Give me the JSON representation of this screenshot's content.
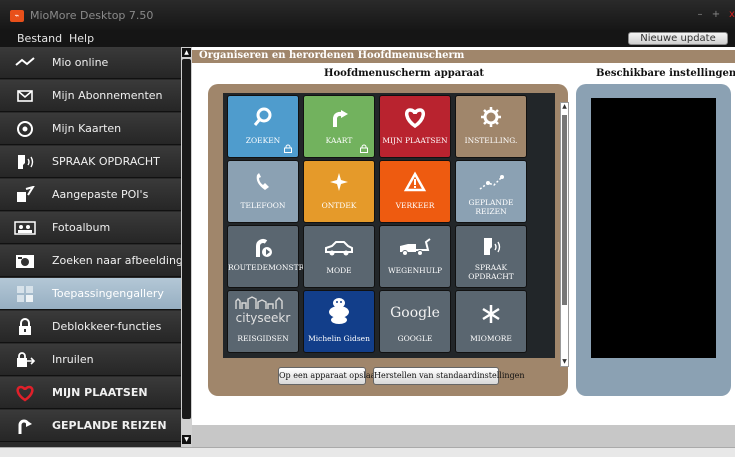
{
  "window": {
    "title": "MioMore Desktop 7.50"
  },
  "menu": {
    "items": [
      "Bestand",
      "Help"
    ],
    "update_button": "Nieuwe update"
  },
  "sidebar": {
    "items": [
      {
        "label": "Mio online",
        "icon": "mio-online-icon"
      },
      {
        "label": "Mijn Abonnementen",
        "icon": "envelope-icon"
      },
      {
        "label": "Mijn Kaarten",
        "icon": "map-compass-icon"
      },
      {
        "label": "SPRAAK OPDRACHT",
        "icon": "voice-command-icon"
      },
      {
        "label": "Aangepaste POI's",
        "icon": "custom-poi-icon"
      },
      {
        "label": "Fotoalbum",
        "icon": "photo-album-icon"
      },
      {
        "label": "Zoeken naar afbeeldingen",
        "icon": "camera-icon"
      },
      {
        "label": "Toepassingengallery",
        "icon": "app-gallery-icon",
        "active": true
      },
      {
        "label": "Deblokkeer-functies",
        "icon": "lock-icon"
      },
      {
        "label": "Inruilen",
        "icon": "trade-in-icon"
      },
      {
        "label": "MIJN PLAATSEN",
        "icon": "heart-icon"
      },
      {
        "label": "GEPLANDE REIZEN",
        "icon": "planned-trip-icon"
      }
    ]
  },
  "main": {
    "header": "Organiseren en herordenen Hoofdmenuscherm",
    "device_title": "Hoofdmenuscherm apparaat",
    "available_title": "Beschikbare instellingen",
    "tiles": [
      {
        "label": "ZOEKEN",
        "color": "#4f9ccd",
        "icon": "search-icon",
        "locked": true
      },
      {
        "label": "KAART",
        "color": "#72b25e",
        "icon": "map-icon",
        "locked": true
      },
      {
        "label": "MIJN PLAATSEN",
        "color": "#b9232f",
        "icon": "heart-icon",
        "locked": false
      },
      {
        "label": "INSTELLING.",
        "color": "#a0866b",
        "icon": "gear-icon",
        "locked": false
      },
      {
        "label": "TELEFOON",
        "color": "#8ba1b3",
        "icon": "phone-icon",
        "locked": false
      },
      {
        "label": "ONTDEK",
        "color": "#e59a2a",
        "icon": "sparkle-icon",
        "locked": false
      },
      {
        "label": "VERKEER",
        "color": "#ee5b10",
        "icon": "traffic-warning-icon",
        "locked": false
      },
      {
        "label": "GEPLANDE REIZEN",
        "color": "#8ba1b3",
        "icon": "planned-route-icon",
        "locked": false
      },
      {
        "label": "ROUTEDEMONSTRATIE",
        "color": "#5a6670",
        "icon": "route-demo-icon",
        "locked": false
      },
      {
        "label": "MODE",
        "color": "#5a6670",
        "icon": "car-icon",
        "locked": false
      },
      {
        "label": "WEGENHULP",
        "color": "#5a6670",
        "icon": "tow-truck-icon",
        "locked": false
      },
      {
        "label": "SPRAAK OPDRACHT",
        "color": "#5a6670",
        "icon": "voice-command-icon",
        "locked": false
      },
      {
        "label": "REISGIDSEN",
        "color": "#5a6670",
        "icon": "cityseekr-logo-icon",
        "locked": false
      },
      {
        "label": "Michelin Gidsen",
        "color": "#123e8a",
        "icon": "michelin-logo-icon",
        "locked": false
      },
      {
        "label": "GOOGLE",
        "color": "#5a6670",
        "icon": "google-logo-icon",
        "locked": false
      },
      {
        "label": "MIOMORE",
        "color": "#5a6670",
        "icon": "snowflake-icon",
        "locked": false
      }
    ],
    "cityseekr_text": "cityseekr",
    "google_text": "Google",
    "save_button": "Op een apparaat opslaan",
    "reset_button": "Herstellen van standaardinstellingen"
  }
}
